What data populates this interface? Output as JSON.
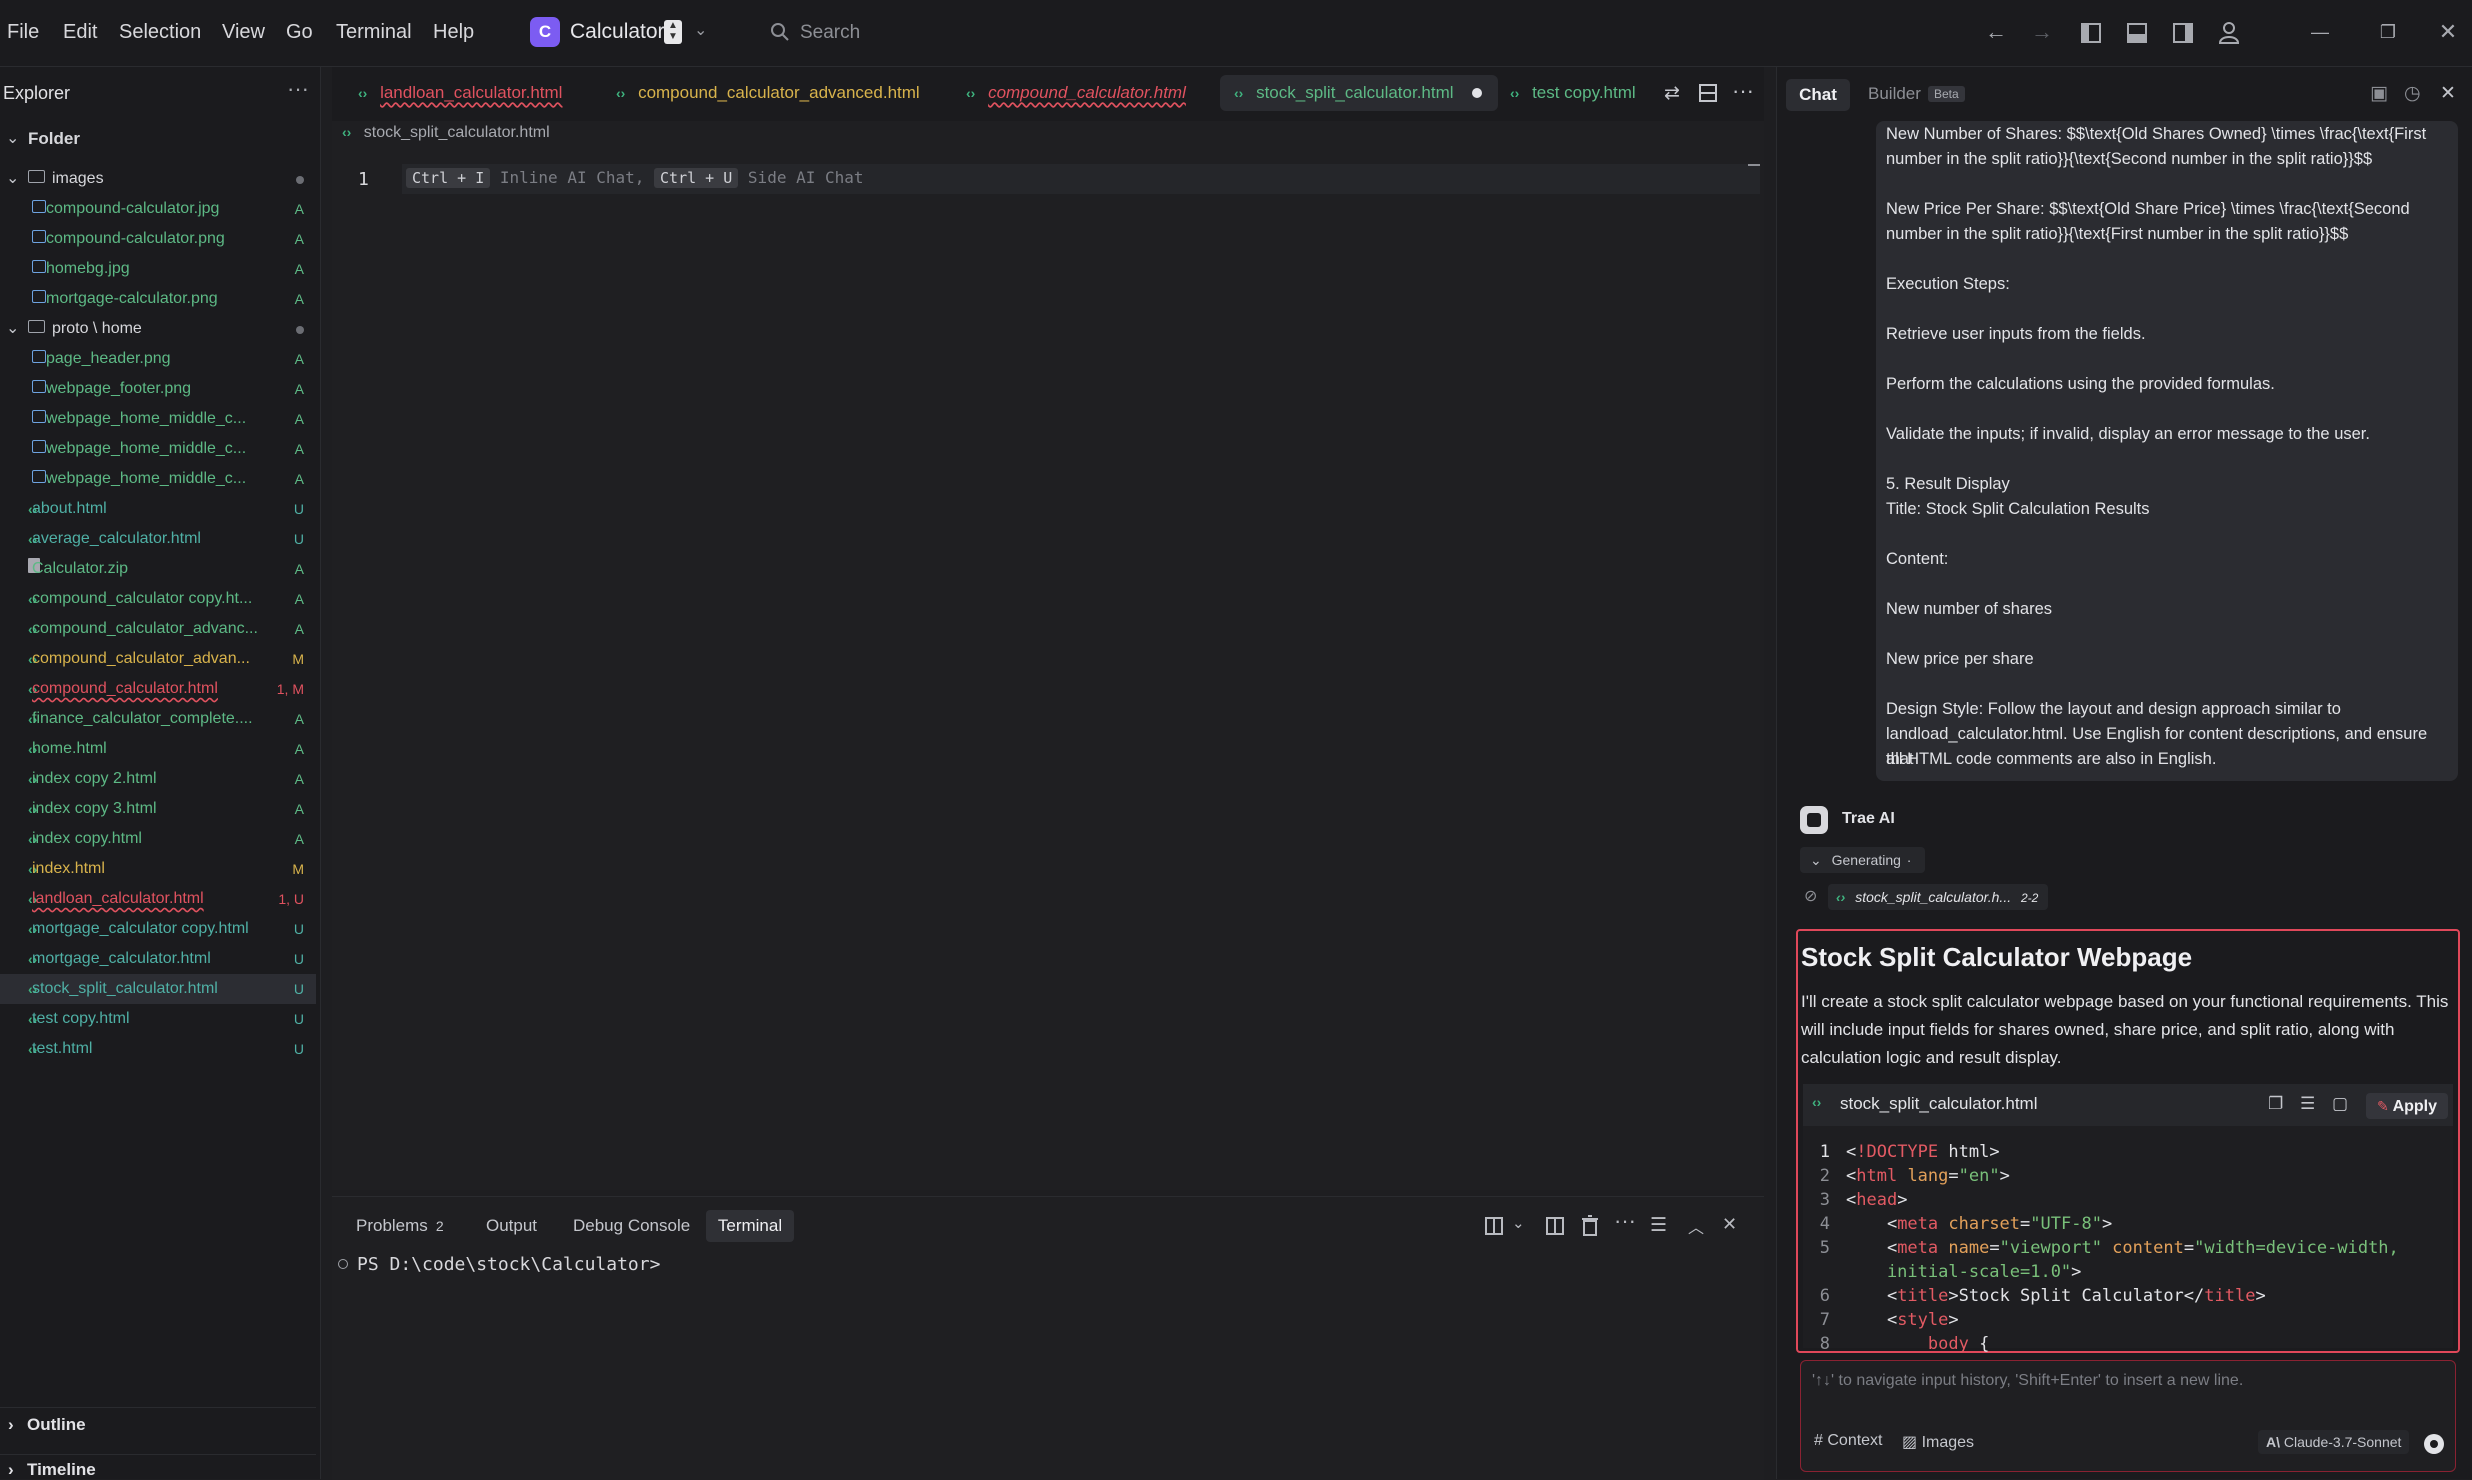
{
  "menu": [
    "File",
    "Edit",
    "Selection",
    "View",
    "Go",
    "Terminal",
    "Help"
  ],
  "app": {
    "logo_letter": "C",
    "name": "Calculator"
  },
  "search": {
    "label": "Search"
  },
  "explorer": {
    "title": "Explorer",
    "folder_label": "Folder",
    "outline_label": "Outline",
    "timeline_label": "Timeline",
    "items": [
      {
        "label": "images",
        "status": ""
      },
      {
        "label": "compound-calculator.jpg",
        "status": "A"
      },
      {
        "label": "compound-calculator.png",
        "status": "A"
      },
      {
        "label": "homebg.jpg",
        "status": "A"
      },
      {
        "label": "mortgage-calculator.png",
        "status": "A"
      },
      {
        "label": "proto \\ home",
        "status": ""
      },
      {
        "label": "page_header.png",
        "status": "A"
      },
      {
        "label": "webpage_footer.png",
        "status": "A"
      },
      {
        "label": "webpage_home_middle_c...",
        "status": "A"
      },
      {
        "label": "webpage_home_middle_c...",
        "status": "A"
      },
      {
        "label": "webpage_home_middle_c...",
        "status": "A"
      },
      {
        "label": "about.html",
        "status": "U"
      },
      {
        "label": "average_calculator.html",
        "status": "U"
      },
      {
        "label": "Calculator.zip",
        "status": "A"
      },
      {
        "label": "compound_calculator copy.ht...",
        "status": "A"
      },
      {
        "label": "compound_calculator_advanc...",
        "status": "A"
      },
      {
        "label": "compound_calculator_advan...",
        "status": "M"
      },
      {
        "label": "compound_calculator.html",
        "status": "1, M"
      },
      {
        "label": "finance_calculator_complete....",
        "status": "A"
      },
      {
        "label": "home.html",
        "status": "A"
      },
      {
        "label": "index copy 2.html",
        "status": "A"
      },
      {
        "label": "index copy 3.html",
        "status": "A"
      },
      {
        "label": "index copy.html",
        "status": "A"
      },
      {
        "label": "index.html",
        "status": "M"
      },
      {
        "label": "landloan_calculator.html",
        "status": "1, U"
      },
      {
        "label": "mortgage_calculator copy.html",
        "status": "U"
      },
      {
        "label": "mortgage_calculator.html",
        "status": "U"
      },
      {
        "label": "stock_split_calculator.html",
        "status": "U"
      },
      {
        "label": "test copy.html",
        "status": "U"
      },
      {
        "label": "test.html",
        "status": "U"
      }
    ]
  },
  "tabs": [
    {
      "label": "landloan_calculator.html"
    },
    {
      "label": "compound_calculator_advanced.html"
    },
    {
      "label": "compound_calculator.html"
    },
    {
      "label": "stock_split_calculator.html"
    },
    {
      "label": "test copy.html"
    }
  ],
  "editor": {
    "breadcrumb": "stock_split_calculator.html",
    "line_number": "1",
    "hint_key1": "Ctrl + I",
    "hint_text1": "Inline AI Chat,",
    "hint_key2": "Ctrl + U",
    "hint_text2": "Side AI Chat"
  },
  "panel": {
    "problems_label": "Problems",
    "problems_count": "2",
    "output_label": "Output",
    "debug_label": "Debug Console",
    "terminal_label": "Terminal",
    "prompt": "PS D:\\code\\stock\\Calculator>"
  },
  "chat": {
    "tab_chat": "Chat",
    "tab_builder": "Builder",
    "beta": "Beta",
    "user_message": [
      "New Number of Shares: $$\\text{Old Shares Owned} \\times \\frac{\\text{First",
      "number in the split ratio}}{\\text{Second number in the split ratio}}$$",
      "",
      "New Price Per Share: $$\\text{Old Share Price} \\times \\frac{\\text{Second",
      "number in the split ratio}}{\\text{First number in the split ratio}}$$",
      "",
      "Execution Steps:",
      "",
      "Retrieve user inputs from the fields.",
      "",
      "Perform the calculations using the provided formulas.",
      "",
      "Validate the inputs; if invalid, display an error message to the user.",
      "",
      "5. Result Display",
      "Title: Stock Split Calculation Results",
      "",
      "Content:",
      "",
      "New number of shares",
      "",
      "New price per share",
      "",
      "Design Style: Follow the layout and design approach similar to",
      "landload_calculator.html. Use English for content descriptions, and ensure that",
      "all HTML code comments are also in English."
    ],
    "ai_name": "Trae AI",
    "generating": "Generating",
    "file_ref": "stock_split_calculator.h...",
    "file_ref_range": "2-2",
    "response_title": "Stock Split Calculator Webpage",
    "response_body": "I'll create a stock split calculator webpage based on your functional requirements. This will include input fields for shares owned, share price, and split ratio, along with calculation logic and result display.",
    "code_file": "stock_split_calculator.html",
    "apply_label": "Apply",
    "input_placeholder": "'↑↓' to navigate input history, 'Shift+Enter' to insert a new line.",
    "context_label": "Context",
    "images_label": "Images",
    "model": "Claude-3.7-Sonnet"
  },
  "code_lines": [
    {
      "n": "1",
      "parts": [
        [
          "t-tag",
          "<"
        ],
        [
          "t-kw",
          "!DOCTYPE"
        ],
        [
          "t-tag",
          " html>"
        ]
      ]
    },
    {
      "n": "2",
      "parts": [
        [
          "t-tag",
          "<"
        ],
        [
          "t-kw",
          "html"
        ],
        [
          "t-at",
          " lang"
        ],
        [
          "t-tag",
          "="
        ],
        [
          "t-str",
          "\"en\""
        ],
        [
          "t-tag",
          ">"
        ]
      ]
    },
    {
      "n": "3",
      "parts": [
        [
          "t-tag",
          "<"
        ],
        [
          "t-kw",
          "head"
        ],
        [
          "t-tag",
          ">"
        ]
      ]
    },
    {
      "n": "4",
      "parts": [
        [
          "t-tag",
          "    <"
        ],
        [
          "t-kw",
          "meta"
        ],
        [
          "t-at",
          " charset"
        ],
        [
          "t-tag",
          "="
        ],
        [
          "t-str",
          "\"UTF-8\""
        ],
        [
          "t-tag",
          ">"
        ]
      ]
    },
    {
      "n": "5",
      "parts": [
        [
          "t-tag",
          "    <"
        ],
        [
          "t-kw",
          "meta"
        ],
        [
          "t-at",
          " name"
        ],
        [
          "t-tag",
          "="
        ],
        [
          "t-str",
          "\"viewport\""
        ],
        [
          "t-at",
          " content"
        ],
        [
          "t-tag",
          "="
        ],
        [
          "t-str",
          "\"width=device-width,"
        ]
      ]
    },
    {
      "n": "",
      "parts": [
        [
          "t-str",
          "    initial-scale=1.0\""
        ],
        [
          "t-tag",
          ">"
        ]
      ]
    },
    {
      "n": "6",
      "parts": [
        [
          "t-tag",
          "    <"
        ],
        [
          "t-kw",
          "title"
        ],
        [
          "t-tag",
          ">"
        ],
        [
          "t-txt",
          "Stock Split Calculator"
        ],
        [
          "t-tag",
          "</"
        ],
        [
          "t-kw",
          "title"
        ],
        [
          "t-tag",
          ">"
        ]
      ]
    },
    {
      "n": "7",
      "parts": [
        [
          "t-tag",
          "    <"
        ],
        [
          "t-kw",
          "style"
        ],
        [
          "t-tag",
          ">"
        ]
      ]
    },
    {
      "n": "8",
      "parts": [
        [
          "t-kw",
          "        body"
        ],
        [
          "t-tag",
          " {"
        ]
      ]
    }
  ],
  "colors": {
    "accent": "#7c5cf2",
    "alert_border": "#e0485a",
    "html_icon": "#3fb37f"
  }
}
